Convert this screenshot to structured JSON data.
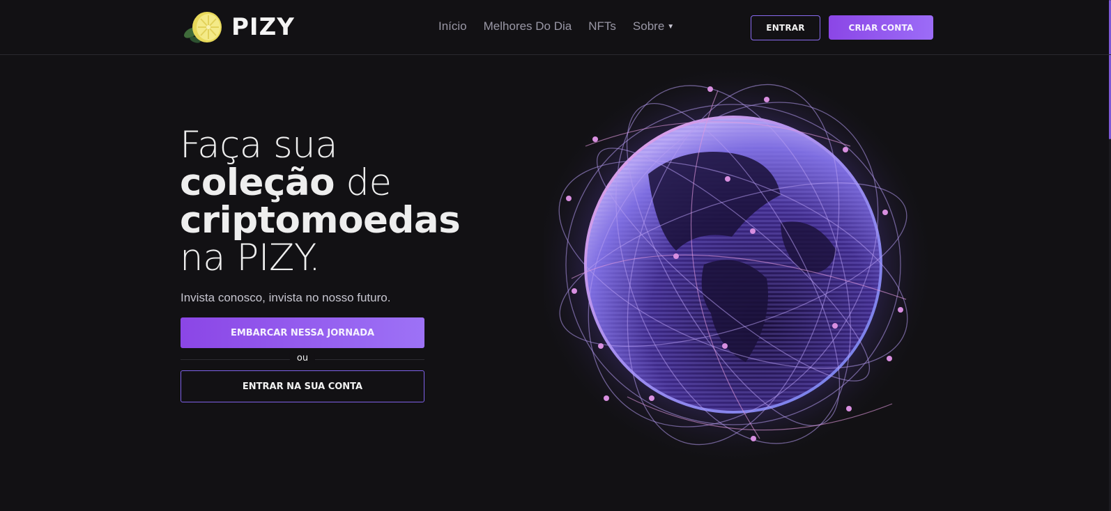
{
  "brand": {
    "name": "PIZY"
  },
  "nav": {
    "items": [
      "Início",
      "Melhores Do Dia",
      "NFTs",
      "Sobre"
    ]
  },
  "header": {
    "login_label": "ENTRAR",
    "signup_label": "CRIAR CONTA"
  },
  "hero": {
    "title_l1": "Faça sua",
    "title_l2_bold": "coleção",
    "title_l2_light": " de",
    "title_l3": "criptomoedas",
    "title_l4": "na PIZY.",
    "subtitle": "Invista conosco, invista no nosso futuro.",
    "primary_button": "EMBARCAR NESSA JORNADA",
    "divider": "ou",
    "secondary_button": "ENTRAR NA SUA CONTA"
  },
  "theme": {
    "background": "#121114",
    "accent": "#8b46e6",
    "accent_light": "#9c6cf7",
    "nav_text": "#9a98a6"
  },
  "icons": [
    "lemon-logo-icon",
    "chevron-down-icon",
    "globe-illustration"
  ]
}
